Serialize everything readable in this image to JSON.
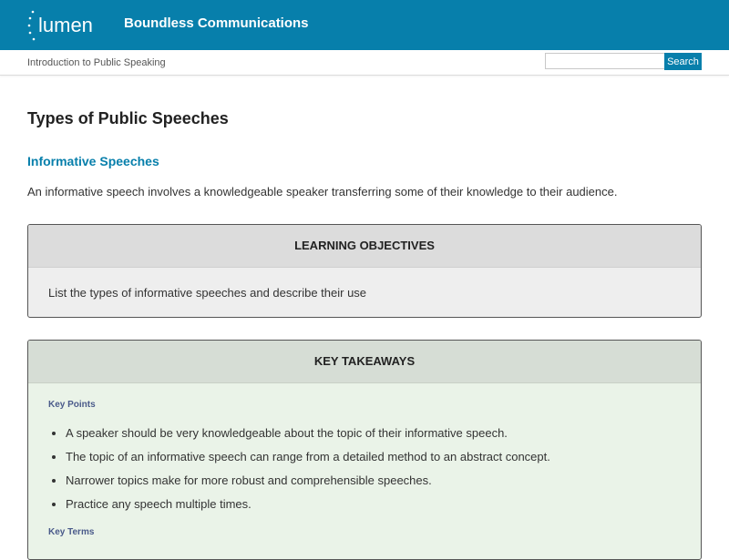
{
  "header": {
    "logo_text": "lumen",
    "site_title": "Boundless Communications"
  },
  "subbar": {
    "breadcrumb": "Introduction to Public Speaking",
    "search_placeholder": "",
    "search_button": "Search"
  },
  "main": {
    "title": "Types of Public Speeches",
    "section_title": "Informative Speeches",
    "intro": "An informative speech involves a knowledgeable speaker transferring some of their knowledge to their audience.",
    "learning_objectives": {
      "heading": "LEARNING OBJECTIVES",
      "text": "List the types of informative speeches and describe their use"
    },
    "key_takeaways": {
      "heading": "KEY TAKEAWAYS",
      "key_points_label": "Key Points",
      "points": [
        "A speaker should be very knowledgeable about the topic of their informative speech.",
        "The topic of an informative speech can range from a detailed method to an abstract concept.",
        "Narrower topics make for more robust and comprehensible speeches.",
        "Practice any speech multiple times."
      ],
      "key_terms_label": "Key Terms"
    }
  },
  "colors": {
    "brand": "#077fab",
    "subheading": "#4a5a8a"
  }
}
